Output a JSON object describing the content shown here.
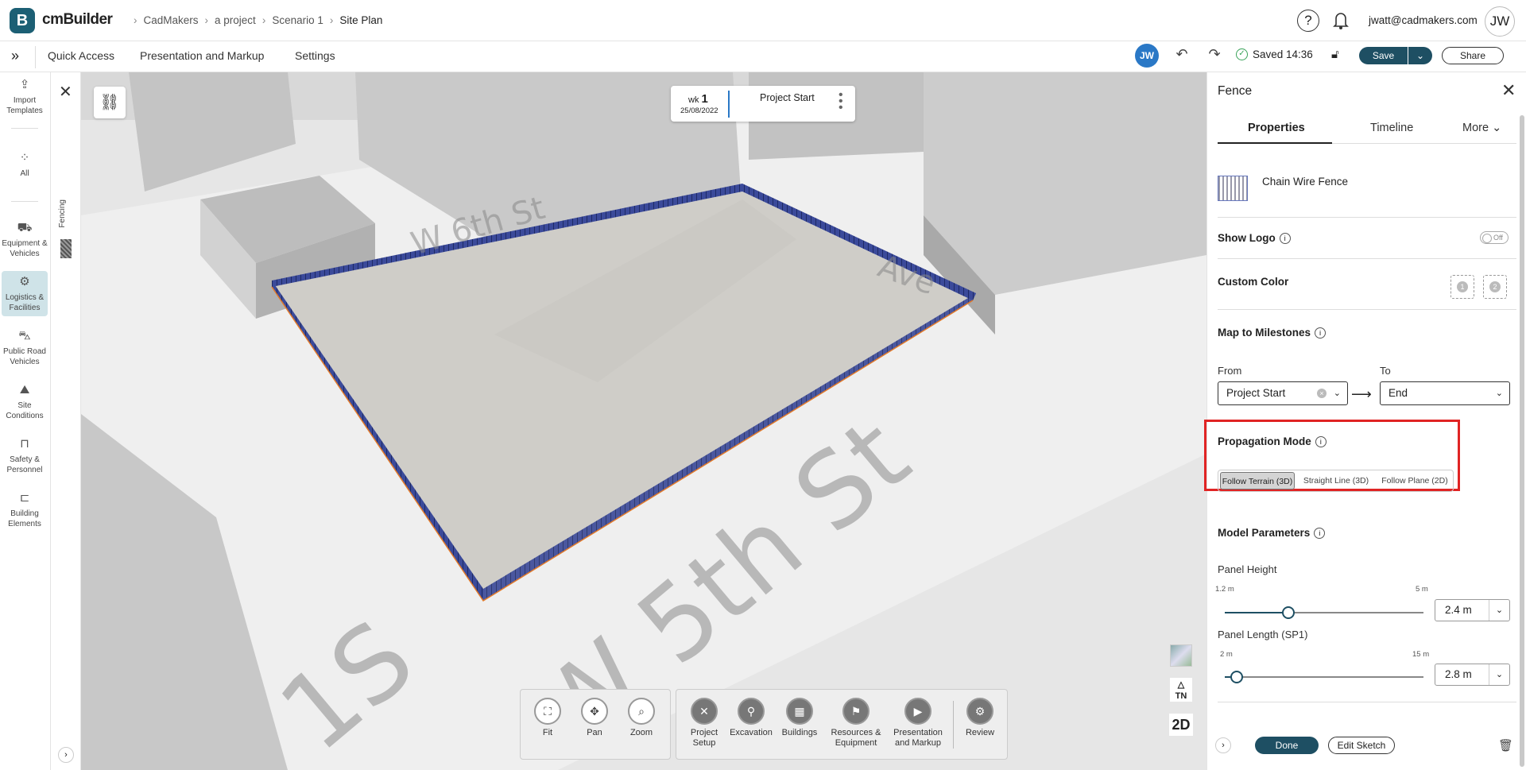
{
  "app": {
    "name": "cmBuilder",
    "logo_letter": "B",
    "accent": "#1e4f63"
  },
  "breadcrumb": [
    "CadMakers",
    "a project",
    "Scenario 1",
    "Site Plan"
  ],
  "header": {
    "help": "?",
    "email": "jwatt@cadmakers.com",
    "avatar": "JW"
  },
  "menubar": {
    "expand_icon": "»",
    "items": [
      "Quick Access",
      "Presentation and Markup",
      "Settings"
    ],
    "user_badge": "JW",
    "saved_text": "Saved 14:36",
    "save_label": "Save",
    "share_label": "Share"
  },
  "leftrail": {
    "items": [
      {
        "label": "Import Templates",
        "icon": "import-icon"
      },
      {
        "label": "All",
        "icon": "grid-icon"
      },
      {
        "label": "Equipment & Vehicles",
        "icon": "excavator-icon"
      },
      {
        "label": "Logistics & Facilities",
        "icon": "facility-icon"
      },
      {
        "label": "Public Road Vehicles",
        "icon": "car-icon"
      },
      {
        "label": "Site Conditions",
        "icon": "terrain-icon"
      },
      {
        "label": "Safety & Personnel",
        "icon": "barrier-icon"
      },
      {
        "label": "Building Elements",
        "icon": "crane-icon"
      }
    ]
  },
  "subpanel": {
    "category": "Fencing"
  },
  "viewport": {
    "timeline_card": {
      "wk_label": "wk",
      "wk_num": "1",
      "date": "25/08/2022",
      "milestone": "Project Start"
    },
    "tn_label": "TN",
    "view_mode": "2D",
    "nav_tools": [
      "Fit",
      "Pan",
      "Zoom"
    ],
    "mode_tools": [
      "Project Setup",
      "Excavation",
      "Buildings",
      "Resources & Equipment",
      "Presentation and Markup",
      "Review"
    ]
  },
  "panel": {
    "title": "Fence",
    "tabs": [
      "Properties",
      "Timeline",
      "More"
    ],
    "item_name": "Chain Wire Fence",
    "show_logo_label": "Show Logo",
    "show_logo_state": "Off",
    "custom_color_label": "Custom Color",
    "custom_color_slots": [
      "1",
      "2"
    ],
    "milestones_label": "Map to Milestones",
    "from_label": "From",
    "to_label": "To",
    "from_value": "Project Start",
    "to_value": "End",
    "propagation_label": "Propagation Mode",
    "propagation_options": [
      "Follow Terrain (3D)",
      "Straight Line (3D)",
      "Follow Plane (2D)"
    ],
    "propagation_selected": "Follow Terrain (3D)",
    "model_params_label": "Model Parameters",
    "panel_height": {
      "label": "Panel Height",
      "min": "1.2 m",
      "max": "5 m",
      "value": "2.4 m",
      "fraction": 0.32
    },
    "panel_length": {
      "label": "Panel Length (SP1)",
      "min": "2 m",
      "max": "15 m",
      "value": "2.8 m",
      "fraction": 0.06
    },
    "done_label": "Done",
    "edit_sketch_label": "Edit Sketch"
  },
  "colors": {
    "fence": "#3b4a9a",
    "highlight": "#e02424",
    "primary": "#1e4f63"
  }
}
